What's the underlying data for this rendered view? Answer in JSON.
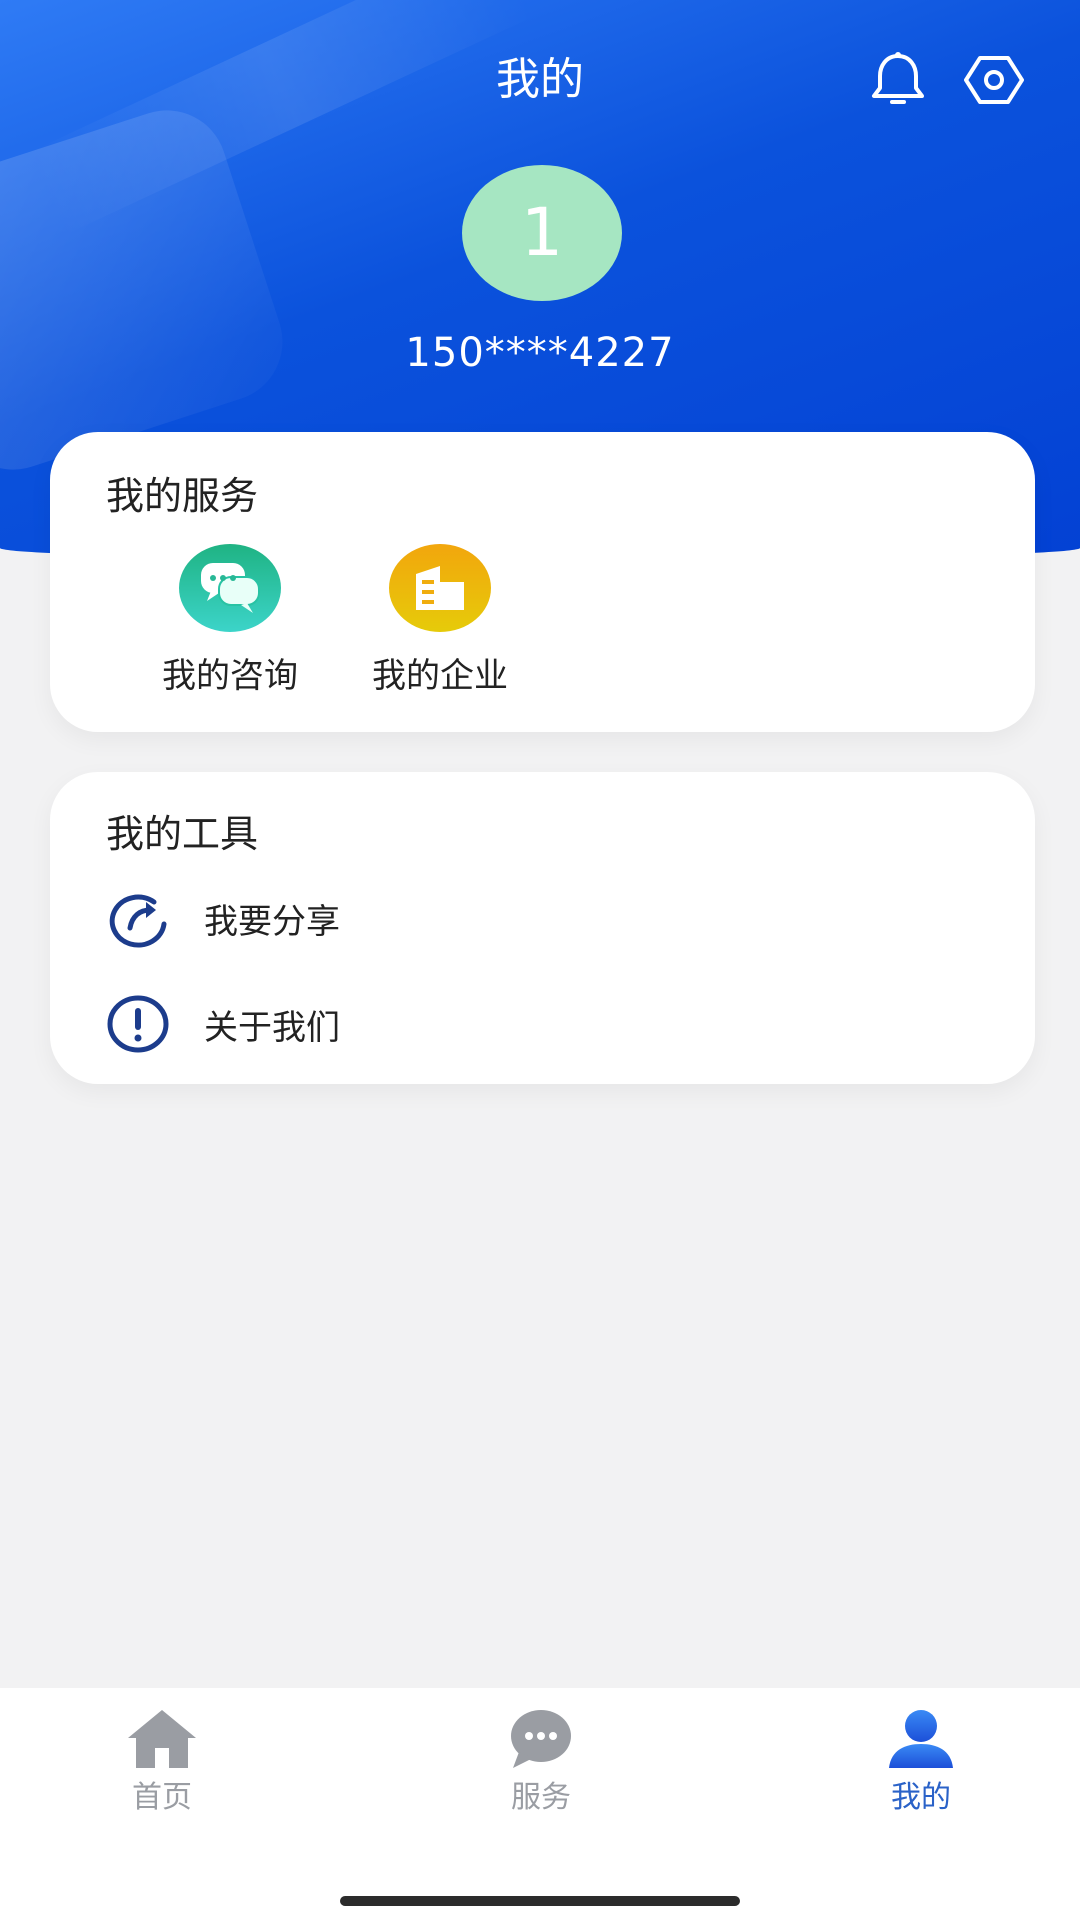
{
  "header": {
    "title": "我的",
    "notification_icon": "bell-icon",
    "settings_icon": "gear-icon"
  },
  "profile": {
    "avatar_text": "1",
    "phone": "150****4227",
    "avatar_color": "#a6e6c2"
  },
  "services": {
    "title": "我的服务",
    "items": [
      {
        "label": "我的咨询",
        "icon": "chat-bubbles-icon",
        "color": "#1fb383"
      },
      {
        "label": "我的企业",
        "icon": "building-icon",
        "color": "#f2a60d"
      }
    ]
  },
  "tools": {
    "title": "我的工具",
    "items": [
      {
        "label": "我要分享",
        "icon": "share-refresh-icon"
      },
      {
        "label": "关于我们",
        "icon": "info-exclamation-icon"
      }
    ]
  },
  "tabbar": {
    "items": [
      {
        "label": "首页",
        "icon": "home-icon",
        "active": false
      },
      {
        "label": "服务",
        "icon": "chat-icon",
        "active": false
      },
      {
        "label": "我的",
        "icon": "user-icon",
        "active": true
      }
    ],
    "active_color": "#2a62c8",
    "inactive_color": "#9a9da3"
  },
  "colors": {
    "header_blue": "#0b52dc",
    "tool_icon_blue": "#1c3c8c"
  }
}
